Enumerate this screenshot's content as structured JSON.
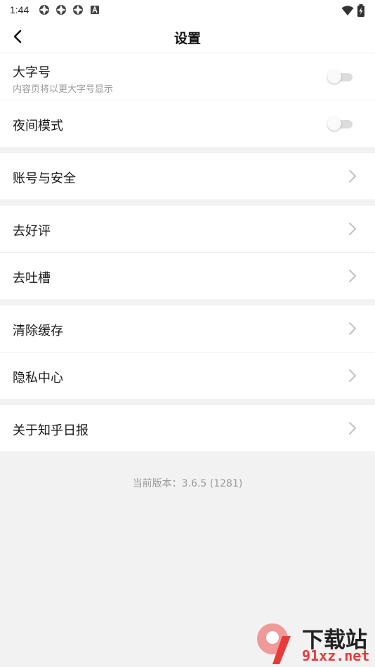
{
  "status_bar": {
    "time": "1:44",
    "left_icons": [
      "notification-icon",
      "notification-icon",
      "notification-icon",
      "app-icon"
    ],
    "right_icons": [
      "wifi-icon",
      "battery-icon"
    ]
  },
  "header": {
    "title": "设置",
    "back_icon": "back-chevron-icon"
  },
  "settings": {
    "large_font": {
      "label": "大字号",
      "sub": "内容页将以更大字号显示",
      "enabled": false
    },
    "night_mode": {
      "label": "夜间模式",
      "enabled": false
    },
    "account_security": {
      "label": "账号与安全"
    },
    "rate": {
      "label": "去好评"
    },
    "feedback": {
      "label": "去吐槽"
    },
    "clear_cache": {
      "label": "清除缓存"
    },
    "privacy": {
      "label": "隐私中心"
    },
    "about": {
      "label": "关于知乎日报"
    }
  },
  "footer": {
    "version": "当前版本：3.6.5 (1281)"
  },
  "watermark": {
    "text": "下载站",
    "url": "91xz.net"
  },
  "colors": {
    "background": "#f2f2f2",
    "card": "#ffffff",
    "toggle_off": "#dcdcdc",
    "watermark_red": "#e83a3a"
  }
}
